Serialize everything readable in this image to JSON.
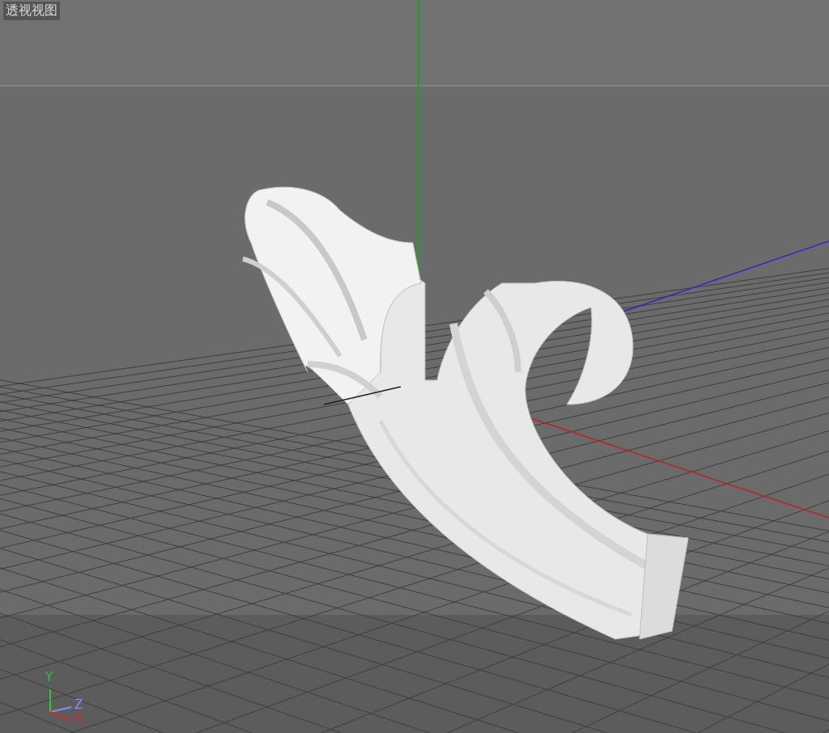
{
  "viewport": {
    "label": "透视视图"
  },
  "axis_gizmo": [
    {
      "axis": "Y",
      "color": "#2ec82e"
    },
    {
      "axis": "Z",
      "color": "#8a8aff"
    },
    {
      "axis": "X",
      "color": "#d02a2a"
    }
  ]
}
